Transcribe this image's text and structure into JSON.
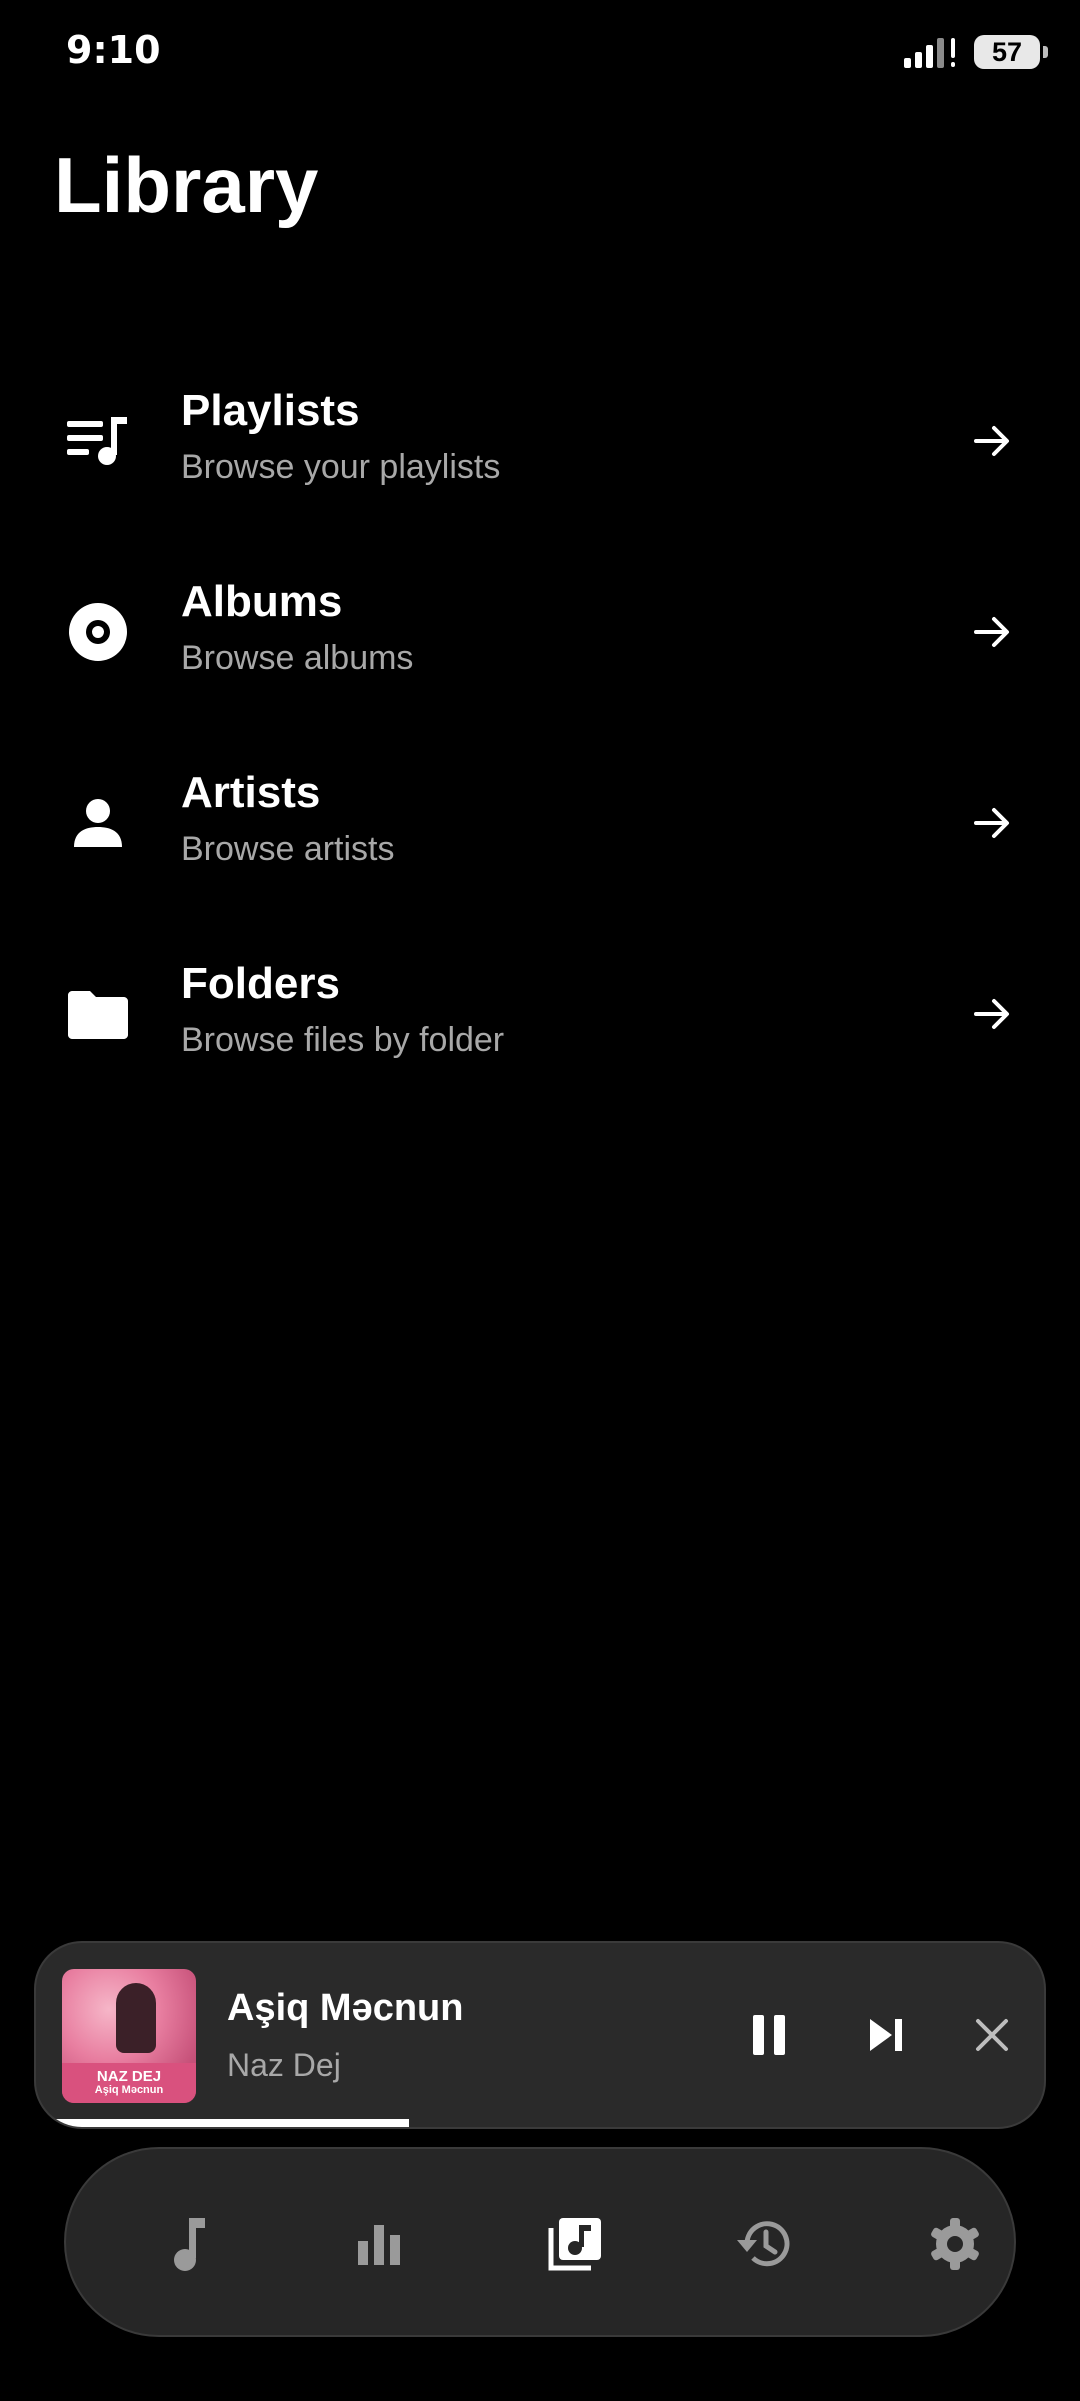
{
  "status_bar": {
    "time": "9:10",
    "battery": "57"
  },
  "page": {
    "title": "Library"
  },
  "library": {
    "items": [
      {
        "title": "Playlists",
        "subtitle": "Browse your playlists",
        "icon": "playlist-icon"
      },
      {
        "title": "Albums",
        "subtitle": "Browse albums",
        "icon": "album-icon"
      },
      {
        "title": "Artists",
        "subtitle": "Browse artists",
        "icon": "artist-icon"
      },
      {
        "title": "Folders",
        "subtitle": "Browse files by folder",
        "icon": "folder-icon"
      }
    ]
  },
  "player": {
    "title": "Aşiq Məcnun",
    "artist": "Naz Dej",
    "art_artist": "NAZ DEJ",
    "art_title": "Aşiq Məcnun",
    "progress": 0.37
  },
  "nav": {
    "items": [
      "music-note-icon",
      "bar-chart-icon",
      "library-music-icon",
      "history-icon",
      "settings-icon"
    ],
    "active": "library-music-icon"
  },
  "colors": {
    "background": "#000000",
    "surface": "#2a2a2a",
    "text_primary": "#ffffff",
    "text_secondary": "#a8a8a8",
    "icon_inactive": "#9a9a9a"
  }
}
